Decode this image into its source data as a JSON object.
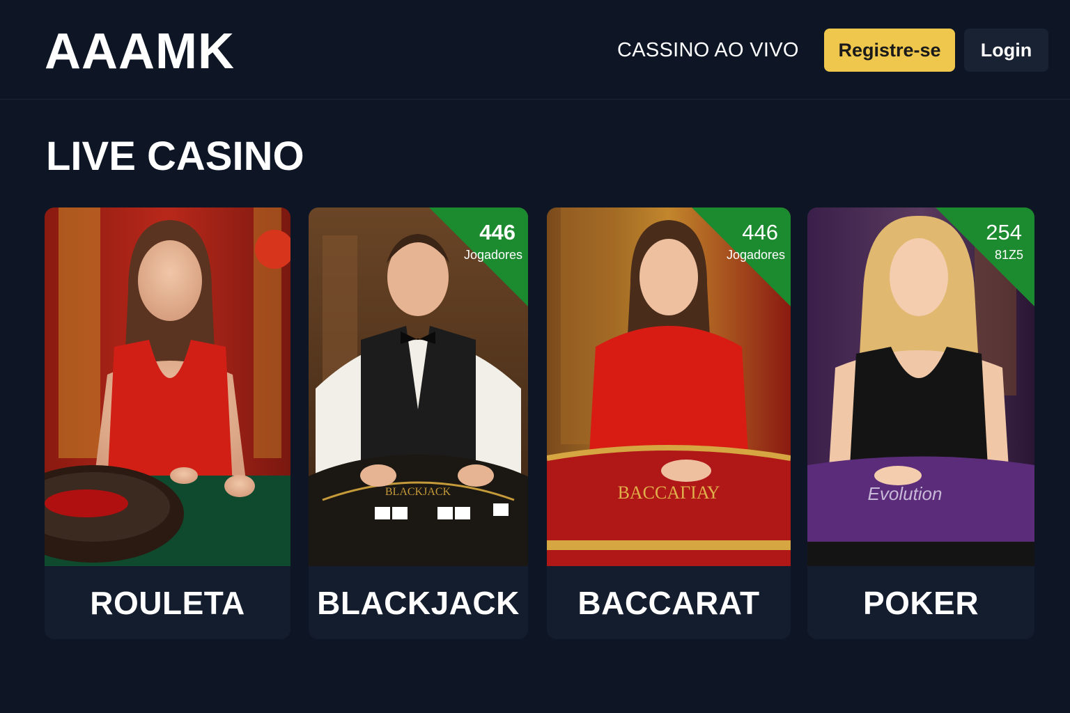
{
  "header": {
    "logo": "AAAMK",
    "nav_link": "CASSINO AO VIVO",
    "register_label": "Registre-se",
    "login_label": "Login"
  },
  "main": {
    "section_title": "LIVE CASINO",
    "cards": [
      {
        "label": "ROULETA",
        "table_text": ""
      },
      {
        "label": "BLACKJACK",
        "badge_count": "446",
        "badge_sub": "Jogadores",
        "table_text": "BLACKJACK"
      },
      {
        "label": "BACCARAT",
        "badge_count": "446",
        "badge_sub": "Jogadores",
        "table_text": "BACCAΓΙΑΥ"
      },
      {
        "label": "POKER",
        "badge_count": "254",
        "badge_sub": "81Z5",
        "table_text": "Evolution"
      }
    ]
  },
  "colors": {
    "background": "#0e1626",
    "card_bg": "#141d2d",
    "accent_yellow": "#eec74c",
    "badge_green": "#1c8a2e"
  }
}
